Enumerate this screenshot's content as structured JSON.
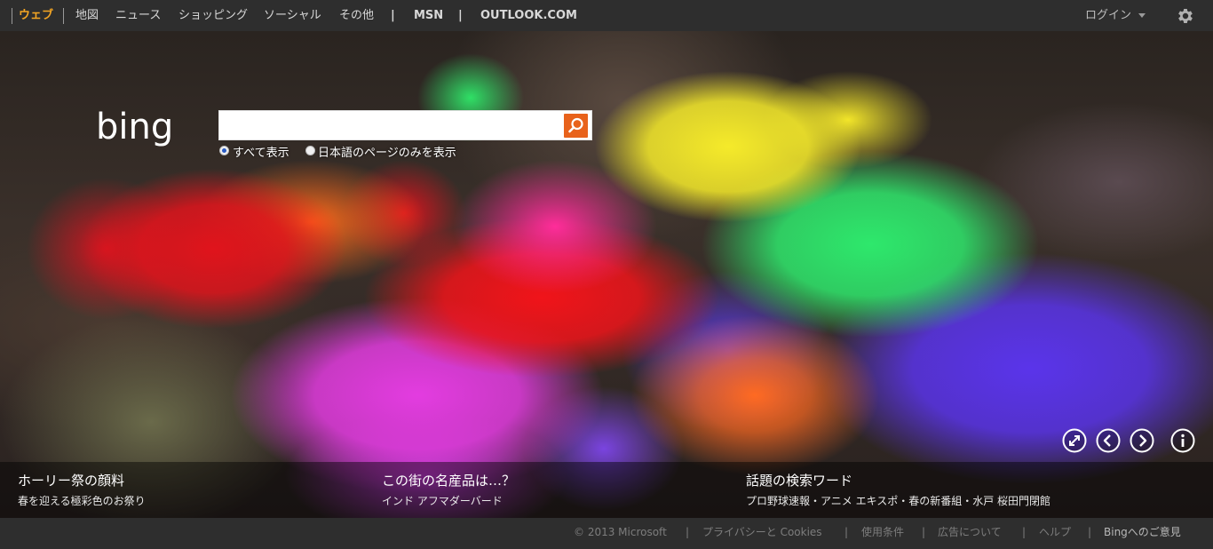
{
  "nav": {
    "items": [
      {
        "label": "ウェブ",
        "active": true
      },
      {
        "label": "地図"
      },
      {
        "label": "ニュース"
      },
      {
        "label": "ショッピング"
      },
      {
        "label": "ソーシャル"
      },
      {
        "label": "その他"
      }
    ],
    "msn": "MSN",
    "outlook": "OUTLOOK.COM",
    "separator": "|",
    "login": "ログイン",
    "settings_icon": "gear-icon"
  },
  "search": {
    "logo_text": "bing",
    "placeholder": "",
    "value": "",
    "button_icon": "search-icon",
    "options": [
      {
        "label": "すべて表示",
        "checked": true
      },
      {
        "label": "日本語のページのみを表示",
        "checked": false
      }
    ]
  },
  "controls": {
    "icons": [
      "fullscreen-icon",
      "previous-icon",
      "next-icon",
      "info-icon"
    ]
  },
  "captions": [
    {
      "title": "ホーリー祭の顔料",
      "subtitle": "春を迎える極彩色のお祭り"
    },
    {
      "title": "この街の名産品は…？",
      "subtitle": "インド アフマダーバード"
    },
    {
      "title": "話題の検索ワード",
      "subtitle": "プロ野球速報・アニメ エキスポ・春の新番組・水戸 桜田門閉館"
    }
  ],
  "footer": {
    "copyright": "© 2013 Microsoft",
    "links": [
      "プライバシーと Cookies",
      "使用条件",
      "広告について",
      "ヘルプ",
      "Bingへのご意見"
    ],
    "separator": "|"
  },
  "colors": {
    "accent": "#f5a623",
    "search_button": "#e8621b",
    "bar_background": "#2e2e2e"
  }
}
